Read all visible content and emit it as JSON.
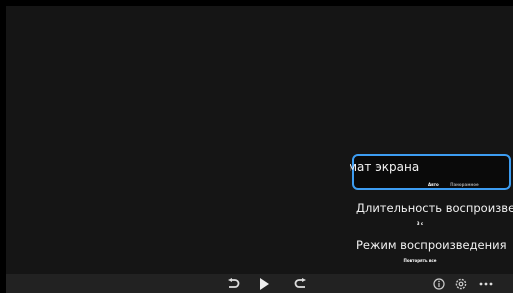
{
  "settings_panel": {
    "items": [
      {
        "title": "мат экрана",
        "options": [
          "Авто",
          "Панорамное"
        ]
      },
      {
        "title": "Длительность воспроизведения",
        "value": "3 с"
      },
      {
        "title": "Режим воспроизведения",
        "value": "Повторять все"
      }
    ]
  },
  "controls": {
    "left": [
      "rewind-icon",
      "play-icon",
      "forward-icon"
    ],
    "right": [
      "info-icon",
      "settings-icon",
      "more-icon"
    ]
  },
  "colors": {
    "accent": "#3d9df2",
    "background": "#000000",
    "bar": "#222222"
  }
}
